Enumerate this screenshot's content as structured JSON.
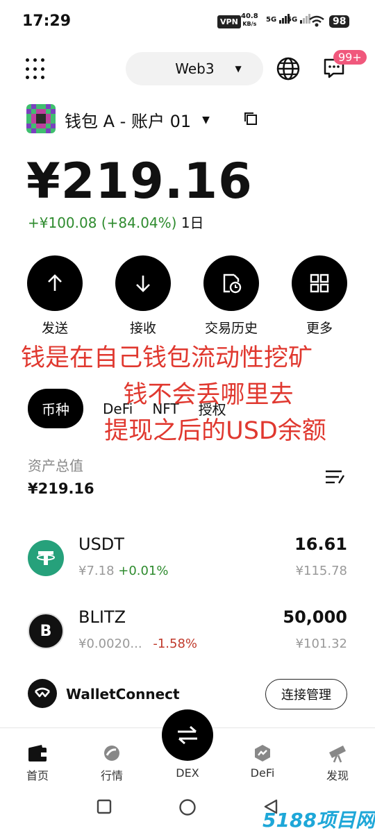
{
  "status": {
    "time": "17:29",
    "vpn": "VPN",
    "speed_value": "40.8",
    "speed_unit": "KB/s",
    "sim1": "5G",
    "sim2": "5G",
    "battery": "98"
  },
  "header": {
    "network_selector": "Web3",
    "notification_badge": "99+"
  },
  "wallet": {
    "name": "钱包 A - 账户 01",
    "balance": "¥219.16",
    "change_amount": "+¥100.08 (+84.04%)",
    "change_period": "1日"
  },
  "actions": [
    {
      "label": "发送",
      "icon": "arrow-up-icon"
    },
    {
      "label": "接收",
      "icon": "arrow-down-icon"
    },
    {
      "label": "交易历史",
      "icon": "history-icon"
    },
    {
      "label": "更多",
      "icon": "grid-four-icon"
    }
  ],
  "tabs": [
    "币种",
    "DeFi",
    "NFT",
    "授权"
  ],
  "overlay_text": [
    "钱是在自己钱包流动性挖矿",
    "钱不会丢哪里去",
    "提现之后的USD余额"
  ],
  "total": {
    "label": "资产总值",
    "value": "¥219.16"
  },
  "assets": [
    {
      "symbol": "USDT",
      "price": "¥7.18",
      "change": "+0.01%",
      "change_dir": "up",
      "amount": "16.61",
      "value": "¥115.78",
      "logo_color": "#26a17b"
    },
    {
      "symbol": "BLITZ",
      "price": "¥0.0020...",
      "change": "-1.58%",
      "change_dir": "down",
      "amount": "50,000",
      "value": "¥101.32",
      "logo_color": "#111111"
    }
  ],
  "walletconnect": {
    "name": "WalletConnect",
    "button": "连接管理"
  },
  "bottom_nav": [
    {
      "label": "首页",
      "icon": "wallet-icon"
    },
    {
      "label": "行情",
      "icon": "market-icon"
    },
    {
      "label": "DEX",
      "icon": "swap-icon"
    },
    {
      "label": "DeFi",
      "icon": "defi-icon"
    },
    {
      "label": "发现",
      "icon": "telescope-icon"
    }
  ],
  "watermark": "5188项目网",
  "colors": {
    "accent": "#000000",
    "positive": "#2e8b2e",
    "negative": "#c0392b",
    "overlay": "#e0382f",
    "badge": "#f0587c"
  }
}
